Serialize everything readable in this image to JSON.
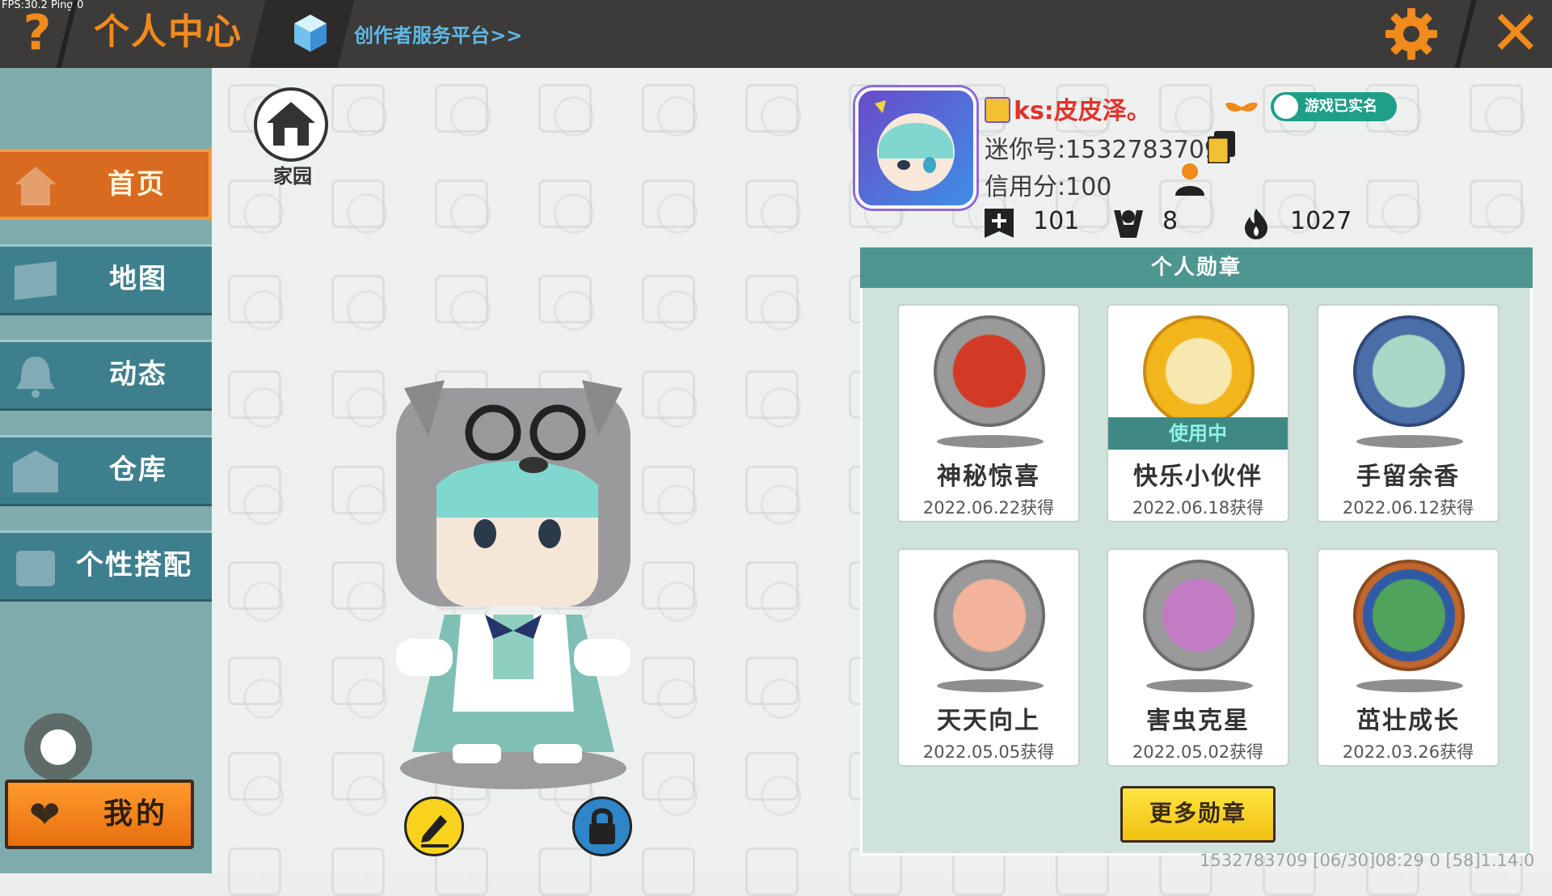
{
  "debug": {
    "fps": "FPS:30.2  Ping:0"
  },
  "header": {
    "help_icon": "?",
    "title": "个人中心",
    "creator_link": "创作者服务平台>>",
    "settings_icon": "gear-icon",
    "close_icon": "✕"
  },
  "sidebar": {
    "items": [
      {
        "label": "首页",
        "active": true
      },
      {
        "label": "地图",
        "active": false
      },
      {
        "label": "动态",
        "active": false
      },
      {
        "label": "仓库",
        "active": false
      },
      {
        "label": "个性搭配",
        "active": false
      }
    ],
    "mine_label": "我的"
  },
  "home": {
    "label": "家园"
  },
  "profile": {
    "username": "ks:皮皮泽。",
    "mini_id": "迷你号:1532783709",
    "credit": "信用分:100",
    "realname_badge": "游戏已实名",
    "stats": {
      "likes": "101",
      "followers": "8",
      "popularity": "1027"
    }
  },
  "medals": {
    "title": "个人勋章",
    "using_label": "使用中",
    "items": [
      {
        "name": "神秘惊喜",
        "date": "2022.06.22获得",
        "color": "#b4281e",
        "in_use": false
      },
      {
        "name": "快乐小伙伴",
        "date": "2022.06.18获得",
        "color": "#f0b81a",
        "in_use": true
      },
      {
        "name": "手留余香",
        "date": "2022.06.12获得",
        "color": "#4a6fa8",
        "in_use": false
      },
      {
        "name": "天天向上",
        "date": "2022.05.05获得",
        "color": "#e2672d",
        "in_use": false
      },
      {
        "name": "害虫克星",
        "date": "2022.05.02获得",
        "color": "#9b4f9a",
        "in_use": false
      },
      {
        "name": "茁壮成长",
        "date": "2022.03.26获得",
        "color": "#2f5aa6",
        "in_use": false
      }
    ],
    "more_label": "更多勋章"
  },
  "footer": "1532783709   [06/30]08:29 0   [58]1.14.0",
  "colors": {
    "accent": "#f28a1c",
    "nav_bg": "#3e7f8d",
    "panel_bg": "#cfe3dc",
    "panel_header": "#4e9590"
  }
}
